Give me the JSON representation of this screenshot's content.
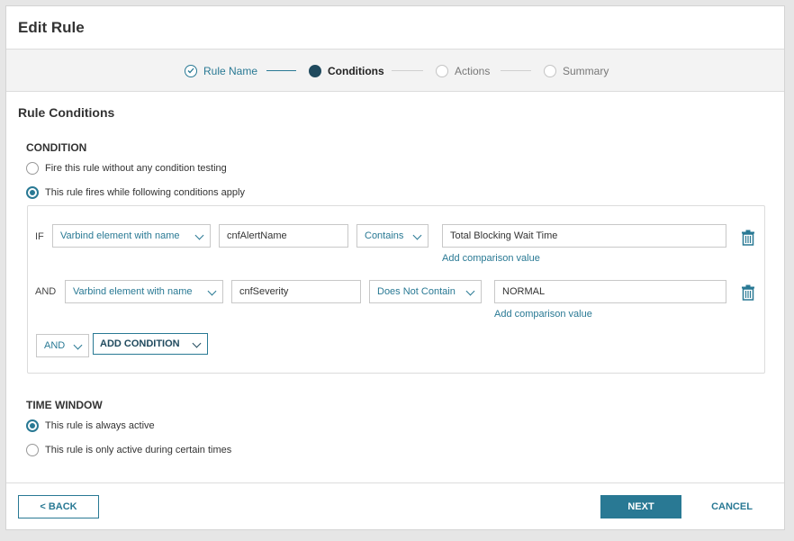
{
  "dialog": {
    "title": "Edit Rule"
  },
  "stepper": {
    "steps": [
      {
        "label": "Rule Name",
        "state": "done"
      },
      {
        "label": "Conditions",
        "state": "active"
      },
      {
        "label": "Actions",
        "state": "pending"
      },
      {
        "label": "Summary",
        "state": "pending"
      }
    ]
  },
  "section_title": "Rule Conditions",
  "condition": {
    "title": "CONDITION",
    "options": [
      {
        "label": "Fire this rule without any condition testing",
        "checked": false
      },
      {
        "label": "This rule fires while following conditions apply",
        "checked": true
      }
    ],
    "rows": [
      {
        "connector": "IF",
        "element_select": "Varbind element with name",
        "name_value": "cnfAlertName",
        "operator": "Contains",
        "comparison_value": "Total Blocking Wait Time",
        "add_comparison_link": "Add comparison value"
      },
      {
        "connector": "AND",
        "element_select": "Varbind element with name",
        "name_value": "cnfSeverity",
        "operator": "Does Not Contain",
        "comparison_value": "NORMAL",
        "add_comparison_link": "Add comparison value"
      }
    ],
    "logic_select": "AND",
    "add_condition_label": "ADD CONDITION"
  },
  "time_window": {
    "title": "TIME WINDOW",
    "options": [
      {
        "label": "This rule is always active",
        "checked": true
      },
      {
        "label": "This rule is only active during certain times",
        "checked": false
      }
    ]
  },
  "footer": {
    "back_label": "< BACK",
    "next_label": "NEXT",
    "cancel_label": "CANCEL"
  },
  "colors": {
    "accent": "#297994",
    "active_step": "#204a5e"
  },
  "icons": {
    "step_done": "check-circle-icon",
    "step_active": "filled-circle-icon",
    "step_pending": "empty-circle-icon",
    "delete": "trash-icon",
    "dropdown": "chevron-down-icon"
  }
}
